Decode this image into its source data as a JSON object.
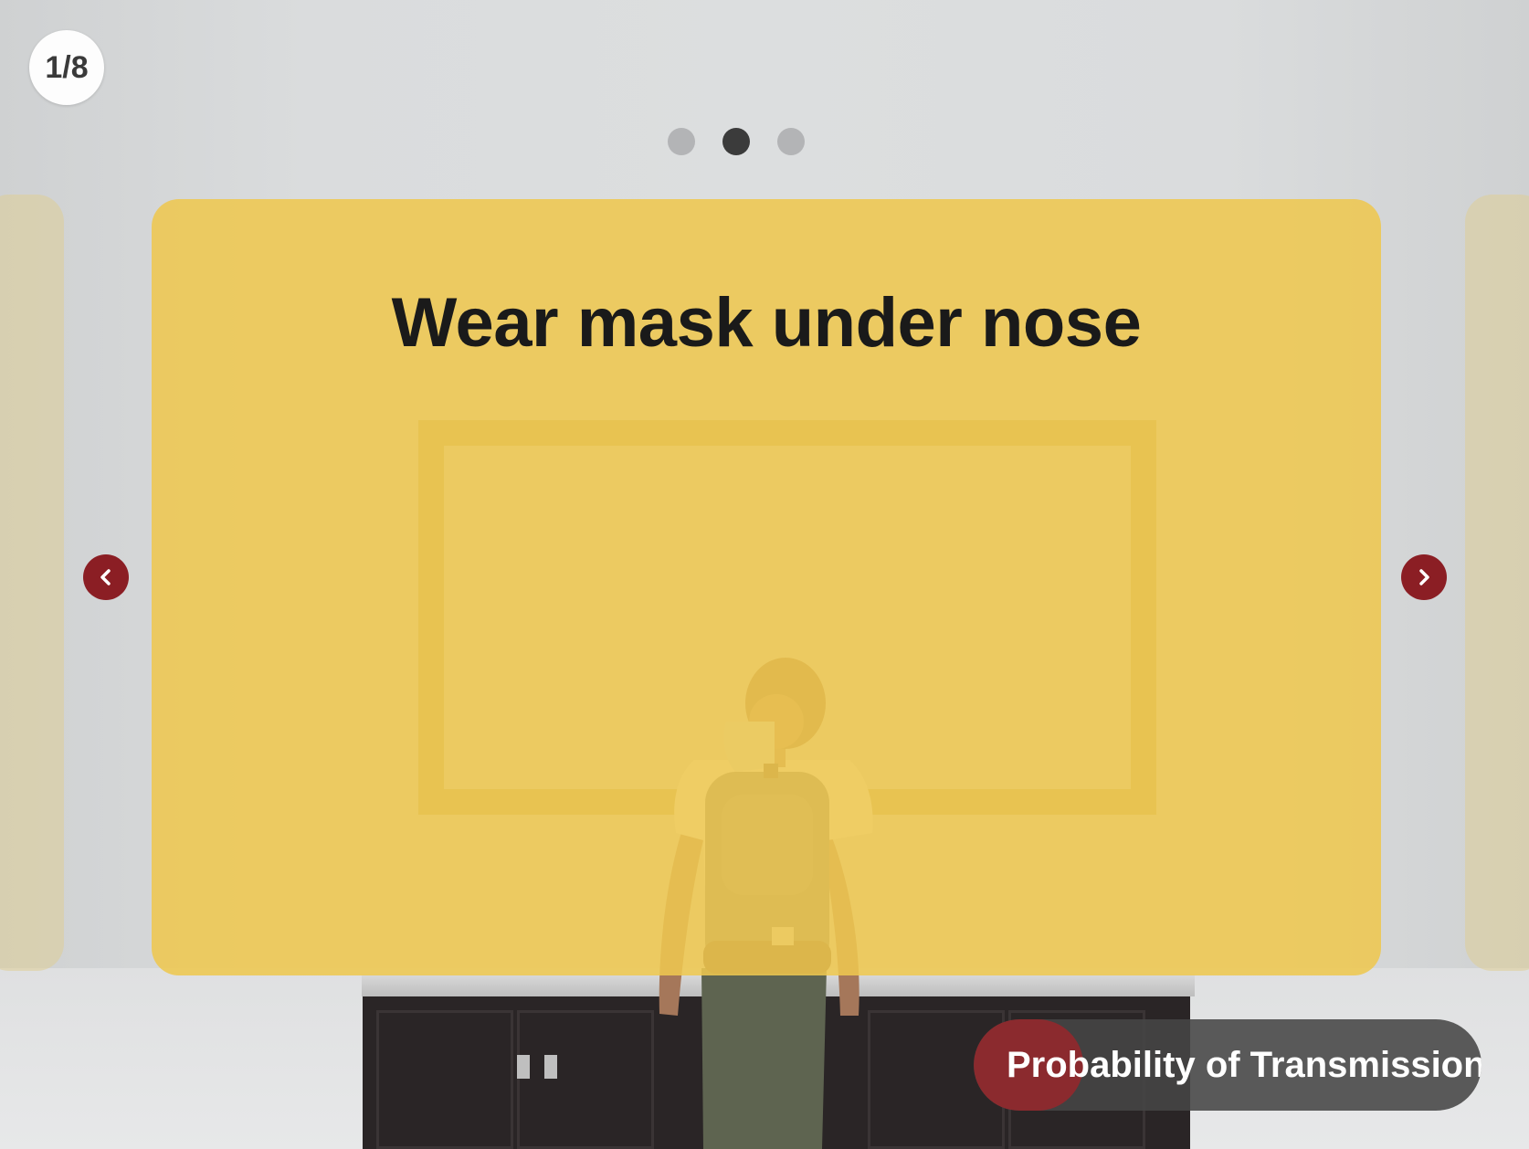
{
  "slide_counter": "1/8",
  "pagination": {
    "count": 3,
    "active_index": 1
  },
  "card": {
    "title": "Wear mask under nose",
    "background_color": "#eec750"
  },
  "nav": {
    "prev_icon": "chevron-left-icon",
    "next_icon": "chevron-right-icon",
    "color": "#8b1e24"
  },
  "footer_button": {
    "label": "Probability of Transmission",
    "accent_color": "#8b2a2e"
  }
}
